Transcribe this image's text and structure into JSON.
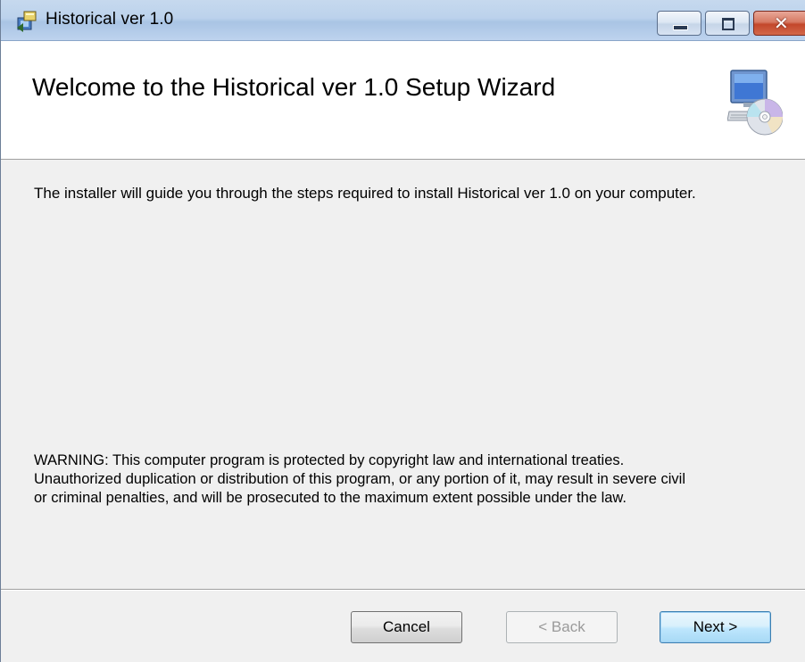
{
  "window": {
    "title": "Historical ver 1.0"
  },
  "banner": {
    "title": "Welcome to the Historical ver 1.0 Setup Wizard",
    "icon": "computer-cd-icon"
  },
  "content": {
    "intro": "The installer will guide you through the steps required to install Historical ver 1.0 on your computer.",
    "warning_lines": [
      "WARNING: This computer program is protected by copyright law and international treaties.",
      "Unauthorized duplication or distribution of this program, or any portion of it, may result in severe civil",
      "or criminal penalties, and will be prosecuted to the maximum extent possible under the law."
    ]
  },
  "buttons": {
    "cancel": "Cancel",
    "back": "< Back",
    "next": "Next >"
  },
  "colors": {
    "titlebar": "#bcd2ec",
    "close_button": "#c3472b",
    "dialog_background": "#f0f0f0",
    "default_button_accent": "#3c7fb1"
  }
}
